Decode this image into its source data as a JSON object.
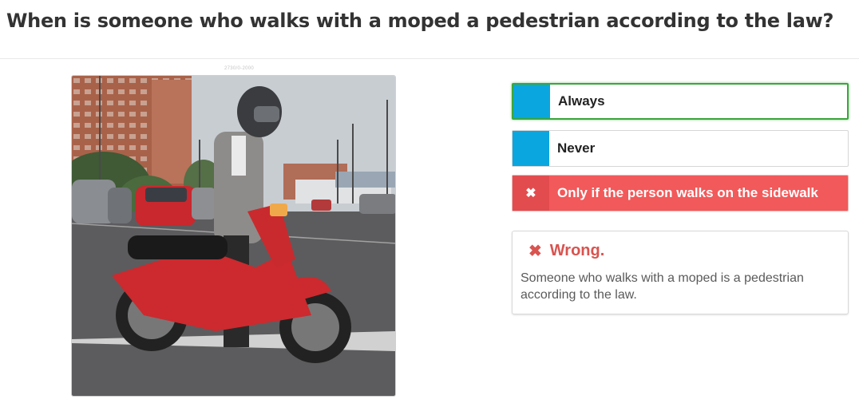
{
  "question": "When is someone who walks with a moped a pedestrian according to the law?",
  "image": {
    "credit": "2730/0-2000",
    "alt": "moped-walking-photo"
  },
  "answers": [
    {
      "label": "Always",
      "state": "selected",
      "marker_icon": "none"
    },
    {
      "label": "Never",
      "state": "default",
      "marker_icon": "none"
    },
    {
      "label": "Only if the person walks on the sidewalk",
      "state": "wrong",
      "marker_icon": "close-icon",
      "marker_glyph": "✖"
    }
  ],
  "feedback": {
    "icon": "close-icon",
    "icon_glyph": "✖",
    "title": "Wrong.",
    "text": "Someone who walks with a moped is a pedestrian according to the law."
  },
  "colors": {
    "marker_blue": "#0aa6df",
    "selected_border": "#3aa63c",
    "wrong_bg": "#f2595a",
    "feedback_red": "#d9534f"
  }
}
